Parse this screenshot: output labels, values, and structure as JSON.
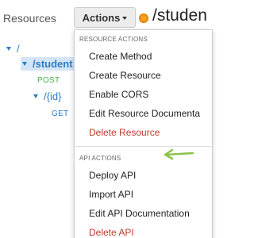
{
  "resources_panel": {
    "title": "Resources",
    "tree": {
      "root": "/",
      "student": "/student",
      "post": "POST",
      "id": "/{id}",
      "get": "GET"
    }
  },
  "header": {
    "actions_label": "Actions",
    "path": "/studen"
  },
  "menu": {
    "resource_actions": {
      "header": "RESOURCE ACTIONS",
      "items": [
        "Create Method",
        "Create Resource",
        "Enable CORS",
        "Edit Resource Documenta",
        "Delete Resource"
      ]
    },
    "api_actions": {
      "header": "API ACTIONS",
      "items": [
        "Deploy API",
        "Import API",
        "Edit API Documentation",
        "Delete API"
      ]
    }
  },
  "colors": {
    "link_blue": "#2f7bc4",
    "post_green": "#4caf50",
    "danger_red": "#c0392b",
    "arrow_green": "#8bc34a"
  },
  "icons": {
    "highlight_arrow": "left-arrow-icon"
  }
}
